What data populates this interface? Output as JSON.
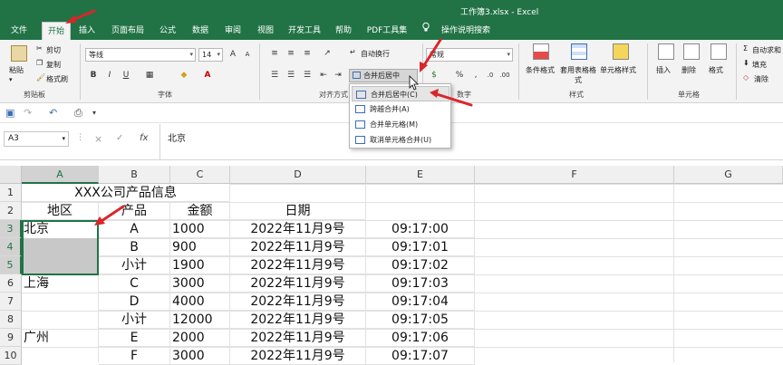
{
  "window": {
    "title": "工作簿3.xlsx  -  Excel"
  },
  "tabs": [
    {
      "label": "文件",
      "active": false
    },
    {
      "label": "开始",
      "active": true
    },
    {
      "label": "插入",
      "active": false
    },
    {
      "label": "页面布局",
      "active": false
    },
    {
      "label": "公式",
      "active": false
    },
    {
      "label": "数据",
      "active": false
    },
    {
      "label": "审阅",
      "active": false
    },
    {
      "label": "视图",
      "active": false
    },
    {
      "label": "开发工具",
      "active": false
    },
    {
      "label": "帮助",
      "active": false
    },
    {
      "label": "PDF工具集",
      "active": false
    },
    {
      "label": "操作说明搜索",
      "active": false
    }
  ],
  "ribbon": {
    "clipboard": {
      "paste": "粘贴",
      "cut": "剪切",
      "copy": "复制",
      "format_painter": "格式刷",
      "group": "剪贴板"
    },
    "font": {
      "font_name": "等线",
      "font_size": "14",
      "bold": "B",
      "italic": "I",
      "underline": "U",
      "grow": "A",
      "shrink": "A",
      "group": "字体"
    },
    "alignment": {
      "wrap": "自动换行",
      "merge_center": "合并后居中",
      "group": "对齐方式"
    },
    "number": {
      "format": "常规",
      "percent": "%",
      "comma": ",",
      "group": "数字"
    },
    "styles": {
      "conditional": "条件格式",
      "table_style": "套用表格格式",
      "cell_style": "单元格样式",
      "group": "样式"
    },
    "cells": {
      "insert": "插入",
      "delete": "删除",
      "format": "格式",
      "group": "单元格"
    },
    "editing": {
      "autosum": "自动求和",
      "fill": "填充",
      "clear": "清除"
    }
  },
  "merge_menu": [
    {
      "label": "合并后居中(C)",
      "highlighted": true
    },
    {
      "label": "跨越合并(A)",
      "highlighted": false
    },
    {
      "label": "合并单元格(M)",
      "highlighted": false
    },
    {
      "label": "取消单元格合并(U)",
      "highlighted": false
    }
  ],
  "formula_bar": {
    "name_box": "A3",
    "cancel": "×",
    "enter": "✓",
    "fx": "fx",
    "value": "北京"
  },
  "columns": [
    "A",
    "B",
    "C",
    "D",
    "E",
    "F",
    "G"
  ],
  "rows": [
    "1",
    "2",
    "3",
    "4",
    "5",
    "6",
    "7",
    "8",
    "9",
    "10"
  ],
  "cells": {
    "title": "XXX公司产品信息",
    "headers": [
      "地区",
      "产品",
      "金额",
      "日期"
    ],
    "data": [
      [
        "北京",
        "A",
        "1000",
        "2022年11月9号",
        "09:17:00"
      ],
      [
        "",
        "B",
        "900",
        "2022年11月9号",
        "09:17:01"
      ],
      [
        "",
        "小计",
        "1900",
        "2022年11月9号",
        "09:17:02"
      ],
      [
        "上海",
        "C",
        "3000",
        "2022年11月9号",
        "09:17:03"
      ],
      [
        "",
        "D",
        "4000",
        "2022年11月9号",
        "09:17:04"
      ],
      [
        "",
        "小计",
        "12000",
        "2022年11月9号",
        "09:17:05"
      ],
      [
        "广州",
        "E",
        "2000",
        "2022年11月9号",
        "09:17:06"
      ],
      [
        "",
        "F",
        "3000",
        "2022年11月9号",
        "09:17:07"
      ]
    ]
  },
  "colors": {
    "excel_green": "#217346",
    "annotation_arrow": "#d9262b"
  }
}
